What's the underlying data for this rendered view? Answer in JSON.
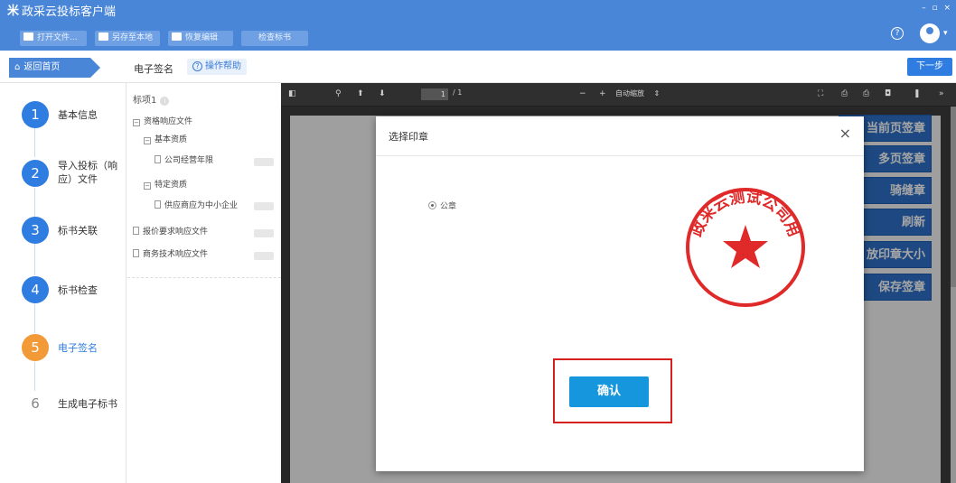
{
  "titlebar": {
    "logo_glyph": "米",
    "app_title": "政采云投标客户端",
    "buttons": [
      {
        "label": "打开文件...",
        "icon": "folder-icon"
      },
      {
        "label": "另存至本地",
        "icon": "save-icon"
      },
      {
        "label": "恢复编辑",
        "icon": "edit-icon"
      },
      {
        "label": "检查标书",
        "icon": ""
      }
    ],
    "window_controls": "– ▫ ×",
    "help_glyph": "?",
    "user_caret": "▾"
  },
  "nav": {
    "back_home_label": "返回首页",
    "home_glyph": "⌂",
    "section_title": "电子签名",
    "help_label": "操作帮助",
    "help_glyph": "?",
    "next_label": "下一步"
  },
  "steps": [
    {
      "number": "1",
      "label": "基本信息",
      "state": "done"
    },
    {
      "number": "2",
      "label": "导入投标（响应）文件",
      "state": "done"
    },
    {
      "number": "3",
      "label": "标书关联",
      "state": "done"
    },
    {
      "number": "4",
      "label": "标书检查",
      "state": "done"
    },
    {
      "number": "5",
      "label": "电子签名",
      "state": "active"
    },
    {
      "number": "6",
      "label": "生成电子标书",
      "state": "pending"
    }
  ],
  "tree": {
    "title": "标项1",
    "info_glyph": "i",
    "collapse_glyph": "−",
    "items": [
      {
        "label": "资格响应文件"
      },
      {
        "label": "基本资质"
      },
      {
        "label": "公司经营年限"
      },
      {
        "label": "特定资质"
      },
      {
        "label": "供应商应为中小企业"
      },
      {
        "label": "报价要求响应文件"
      },
      {
        "label": "商务技术响应文件"
      }
    ]
  },
  "viewer": {
    "sidebar_toggle_glyph": "◧",
    "search_glyph": "⚲",
    "prev_glyph": "⬆",
    "next_glyph": "⬇",
    "page_current": "1",
    "page_count": "/ 1",
    "zoom_out_glyph": "−",
    "zoom_in_glyph": "+",
    "zoom_value": "自动缩放",
    "zoom_caret": "⇕",
    "right_tools": [
      "⛶",
      "⎙",
      "⎙",
      "◘",
      "❚",
      "»"
    ],
    "stamp_buttons": [
      "当前页签章",
      "多页签章",
      "骑缝章",
      "刷新",
      "放印章大小",
      "保存签章"
    ]
  },
  "dialog": {
    "title": "选择印章",
    "close_glyph": "×",
    "option_label": "公章",
    "seal_text": "政采云测试公司用",
    "seal_color": "#e02a2a",
    "confirm_label": "确认"
  },
  "colors": {
    "brand": "#4a86d8",
    "accent_blue": "#2f7de0",
    "active_step": "#f39a38",
    "confirm": "#1696dc",
    "highlight": "#d62020"
  }
}
